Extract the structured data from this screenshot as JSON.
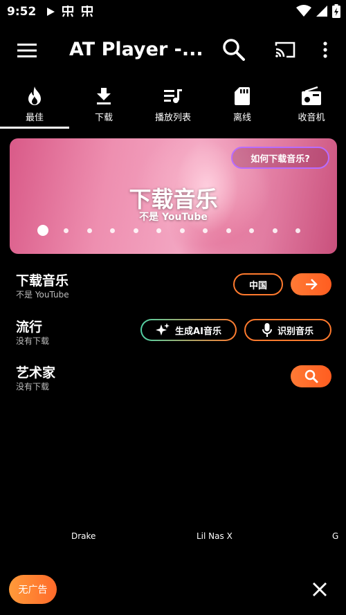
{
  "status_bar": {
    "time": "9:52"
  },
  "app_bar": {
    "title": "AT Player -..."
  },
  "tabs": [
    {
      "label": "最佳",
      "icon": "flame-icon",
      "active": true
    },
    {
      "label": "下载",
      "icon": "download-icon"
    },
    {
      "label": "播放列表",
      "icon": "playlist-icon"
    },
    {
      "label": "离线",
      "icon": "sd-card-icon"
    },
    {
      "label": "收音机",
      "icon": "radio-icon"
    }
  ],
  "banner": {
    "help_label": "如何下载音乐?",
    "title": "下载音乐",
    "subtitle": "不是 YouTube",
    "page_count": 12,
    "active_page": 1
  },
  "sections": {
    "download": {
      "title": "下载音乐",
      "subtitle": "不是 YouTube",
      "region_label": "中国"
    },
    "trending": {
      "title": "流行",
      "subtitle": "没有下载",
      "ai_label": "生成AI音乐",
      "identify_label": "识别音乐"
    },
    "artists": {
      "title": "艺术家",
      "subtitle": "没有下载"
    }
  },
  "artists": [
    "Drake",
    "Lil Nas X",
    "G"
  ],
  "bottom": {
    "no_ads_label": "无广告"
  },
  "colors": {
    "accent": "#ff6a2a",
    "help_border": "#b76cff",
    "ai_border_start": "#4fd1a5",
    "ai_border_end": "#ff7a2e"
  }
}
